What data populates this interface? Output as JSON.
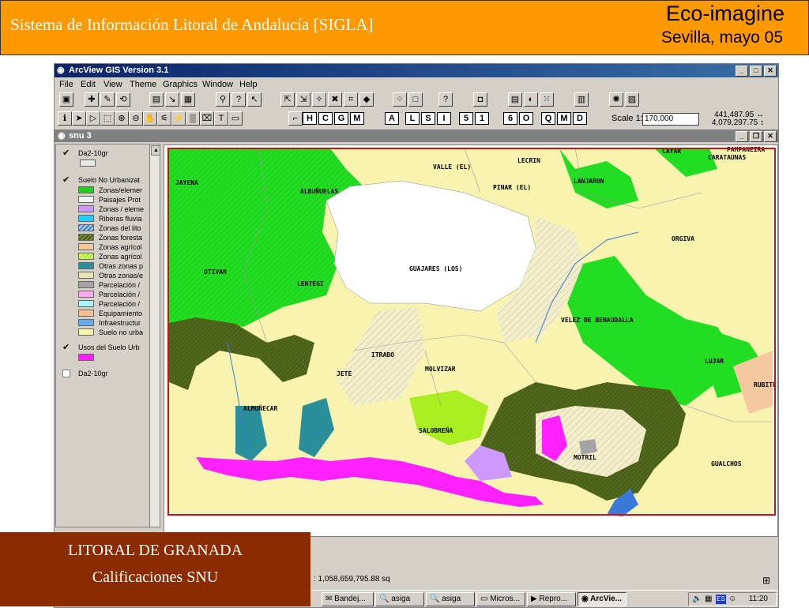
{
  "header": {
    "title": "Sistema de Información Litoral de Andalucía [SIGLA]",
    "brand": "Eco-imagine",
    "date": "Sevilla, mayo 05"
  },
  "window": {
    "title": "ArcView GIS Version 3.1",
    "menu": [
      "File",
      "Edit",
      "View",
      "Theme",
      "Graphics",
      "Window",
      "Help"
    ],
    "letter_tools": [
      "H",
      "C",
      "G",
      "M",
      "A",
      "L",
      "S",
      "I",
      "5",
      "1",
      "6",
      "O",
      "Q",
      "M",
      "D"
    ],
    "scale_label": "Scale 1:",
    "scale_value": "170,000",
    "coord_x": "441,487.95",
    "coord_y": "4,079,297.75"
  },
  "doc": {
    "title": "snu 3"
  },
  "toc": {
    "layer1": {
      "name": "Da2-10gr",
      "checked": true
    },
    "layer2": {
      "name": "Suelo No Urbanizat",
      "checked": true,
      "legend": [
        {
          "label": "Zonas/elemer",
          "color": "#22cc22"
        },
        {
          "label": "Paisajes Prot",
          "color": "#f2f2f2"
        },
        {
          "label": "Zonas / eleme",
          "color": "#cc99ff"
        },
        {
          "label": "Riberas fluvia",
          "color": "#22ccff"
        },
        {
          "label": "Zonas del lito",
          "color": "#3a7ad8"
        },
        {
          "label": "Zonas foresta",
          "color": "#4a6018"
        },
        {
          "label": "Zonas agrícol",
          "color": "#f6c8a0"
        },
        {
          "label": "Zonas agrícol",
          "color": "#aaee22"
        },
        {
          "label": "Otras zonas p",
          "color": "#2a8f98"
        },
        {
          "label": "Otras zonas/e",
          "color": "#f1ecc0"
        },
        {
          "label": "Parcelación /",
          "color": "#a4a4a4"
        },
        {
          "label": "Parcelación /",
          "color": "#ffaaee"
        },
        {
          "label": "Parcelación /",
          "color": "#aaf4f8"
        },
        {
          "label": "Equipamiento",
          "color": "#f8c090"
        },
        {
          "label": "Infraestructur",
          "color": "#66aaee"
        },
        {
          "label": "Suelo no urba",
          "color": "#f8f4b0"
        }
      ]
    },
    "layer3": {
      "name": "Usos del Suelo Urb",
      "checked": true,
      "color": "#ff22ff"
    },
    "layer4": {
      "name": "Da2-10gr",
      "checked": false
    }
  },
  "map": {
    "places": [
      {
        "name": "CAYAR"
      },
      {
        "name": "PAMPANEIRA"
      },
      {
        "name": "CARATAUNAS"
      },
      {
        "name": "VALLE (EL)"
      },
      {
        "name": "LECRIN"
      },
      {
        "name": "JAYENA"
      },
      {
        "name": "ALBUÑUELAS"
      },
      {
        "name": "PINAR (EL)"
      },
      {
        "name": "LANJARON"
      },
      {
        "name": "ORGIVA"
      },
      {
        "name": "GUAJARES (LOS)"
      },
      {
        "name": "OTIVAR"
      },
      {
        "name": "LENTEGI"
      },
      {
        "name": "VELEZ DE BENAUDALLA"
      },
      {
        "name": "ITRABO"
      },
      {
        "name": "JETE"
      },
      {
        "name": "MOLVIZAR"
      },
      {
        "name": "LUJAR"
      },
      {
        "name": "RUBITE"
      },
      {
        "name": "ALMUÑECAR"
      },
      {
        "name": "SALOBREÑA"
      },
      {
        "name": "MOTRIL"
      },
      {
        "name": "GUALCHOS"
      }
    ],
    "colors": {
      "green": "#22dd22",
      "yellow": "#f8f4b0",
      "forest": "#4a6018",
      "magenta": "#ff22ff",
      "lime": "#aaee22",
      "teal": "#2a8f98",
      "lavender": "#cc99ff",
      "peach": "#f6c8a0",
      "blue": "#3a7ad8",
      "red_frame": "#d01010"
    }
  },
  "status": {
    "area": ": 1,058,659,795.88 sq"
  },
  "taskbar": {
    "items": [
      "Bandej...",
      "asiga",
      "asiga",
      "Micros...",
      "Repro...",
      "ArcVie..."
    ],
    "time": "11:20",
    "lang": "ES"
  },
  "caption": {
    "line1": "LITORAL DE GRANADA",
    "line2": "Calificaciones SNU"
  }
}
